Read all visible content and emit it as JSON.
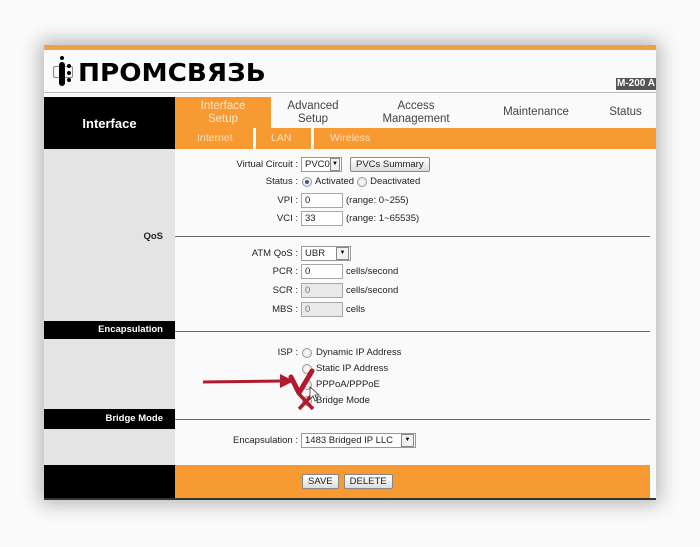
{
  "brand": {
    "logo_text": "ПРОМСВЯЗЬ",
    "model": "M-200 A"
  },
  "nav": {
    "section_title": "Interface",
    "tabs": [
      {
        "label_line1": "Interface",
        "label_line2": "Setup",
        "active": true
      },
      {
        "label_line1": "Advanced",
        "label_line2": "Setup",
        "active": false
      },
      {
        "label_line1": "Access",
        "label_line2": "Management",
        "active": false
      },
      {
        "label_line1": "Maintenance",
        "label_line2": "",
        "active": false
      },
      {
        "label_line1": "Status",
        "label_line2": "",
        "active": false
      }
    ],
    "subtabs": [
      {
        "label": "Internet"
      },
      {
        "label": "LAN"
      },
      {
        "label": "Wireless"
      }
    ]
  },
  "sidebar": {
    "qos_label": "QoS",
    "encapsulation_header": "Encapsulation",
    "bridge_mode_header": "Bridge Mode"
  },
  "pvc": {
    "virtual_circuit_label": "Virtual Circuit :",
    "virtual_circuit_value": "PVC0",
    "pvcs_summary_button": "PVCs Summary",
    "status_label": "Status :",
    "status_options": [
      "Activated",
      "Deactivated"
    ],
    "status_selected": "Activated",
    "vpi_label": "VPI :",
    "vpi_value": "0",
    "vpi_range": "(range: 0~255)",
    "vci_label": "VCI :",
    "vci_value": "33",
    "vci_range": "(range: 1~65535)"
  },
  "qos": {
    "atm_qos_label": "ATM QoS :",
    "atm_qos_value": "UBR",
    "pcr_label": "PCR :",
    "pcr_value": "0",
    "pcr_unit": "cells/second",
    "scr_label": "SCR :",
    "scr_value": "0",
    "scr_unit": "cells/second",
    "mbs_label": "MBS :",
    "mbs_value": "0",
    "mbs_unit": "cells"
  },
  "isp": {
    "label": "ISP :",
    "options": [
      "Dynamic IP Address",
      "Static IP Address",
      "PPPoA/PPPoE",
      "Bridge Mode"
    ]
  },
  "bridge": {
    "encapsulation_label": "Encapsulation :",
    "encapsulation_value": "1483 Bridged IP LLC"
  },
  "actions": {
    "save": "SAVE",
    "delete": "DELETE"
  },
  "colors": {
    "accent": "#f79a32",
    "annotation": "#b01c2e"
  }
}
